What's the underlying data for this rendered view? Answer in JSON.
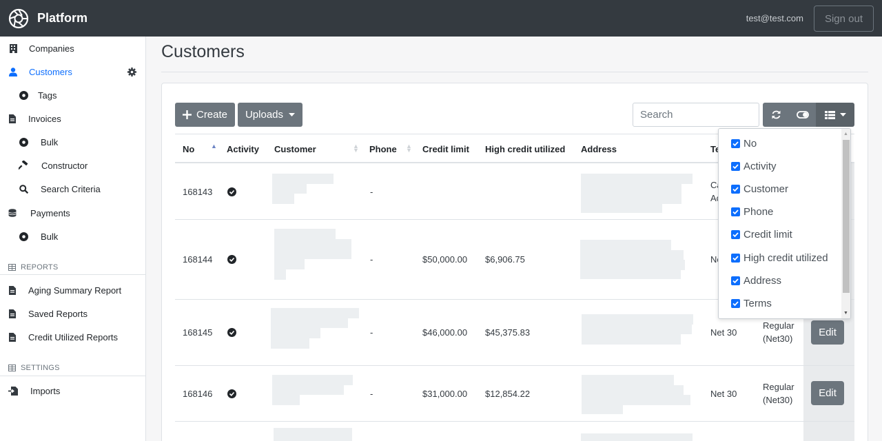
{
  "app": {
    "name": "Platform",
    "user_email": "test@test.com",
    "signout_label": "Sign out"
  },
  "sidebar": {
    "items": [
      {
        "label": "Companies",
        "icon": "building-icon"
      },
      {
        "label": "Customers",
        "icon": "user-icon",
        "active": true
      },
      {
        "label": "Tags",
        "icon": "dot-circle-icon"
      },
      {
        "label": "Invoices",
        "icon": "file-icon"
      },
      {
        "label": "Bulk",
        "icon": "dot-circle-icon"
      },
      {
        "label": "Constructor",
        "icon": "hammer-icon"
      },
      {
        "label": "Search Criteria",
        "icon": "search-icon"
      },
      {
        "label": "Payments",
        "icon": "coins-icon"
      },
      {
        "label": "Bulk",
        "icon": "dot-circle-icon"
      }
    ],
    "reports_header": "REPORTS",
    "reports": [
      {
        "label": "Aging Summary Report"
      },
      {
        "label": "Saved Reports"
      },
      {
        "label": "Credit Utilized Reports"
      }
    ],
    "settings_header": "SETTINGS",
    "settings": [
      {
        "label": "Imports"
      }
    ]
  },
  "main": {
    "title": "Customers",
    "create_label": "Create",
    "uploads_label": "Uploads",
    "search_placeholder": "Search"
  },
  "table": {
    "columns": [
      "No",
      "Activity",
      "Customer",
      "Phone",
      "Credit limit",
      "High credit utilized",
      "Address",
      "Te"
    ],
    "rows": [
      {
        "no": "168143",
        "phone": "-",
        "credit_limit": "",
        "high_credit": "",
        "terms": "Ca",
        "terms2": "Ac",
        "type": "",
        "edit": ""
      },
      {
        "no": "168144",
        "phone": "-",
        "credit_limit": "$50,000.00",
        "high_credit": "$6,906.75",
        "terms": "Ne",
        "terms2": "",
        "type": "",
        "edit": ""
      },
      {
        "no": "168145",
        "phone": "-",
        "credit_limit": "$46,000.00",
        "high_credit": "$45,375.83",
        "terms": "Net 30",
        "terms2": "",
        "type": "Regular",
        "type2": "(Net30)",
        "edit": "Edit"
      },
      {
        "no": "168146",
        "phone": "-",
        "credit_limit": "$31,000.00",
        "high_credit": "$12,854.22",
        "terms": "Net 30",
        "terms2": "",
        "type": "Regular",
        "type2": "(Net30)",
        "edit": "Edit"
      }
    ]
  },
  "column_menu": {
    "items": [
      "No",
      "Activity",
      "Customer",
      "Phone",
      "Credit limit",
      "High credit utilized",
      "Address",
      "Terms"
    ]
  },
  "colors": {
    "topbar": "#343a40",
    "accent": "#0d6efd",
    "button": "#6c757d"
  }
}
